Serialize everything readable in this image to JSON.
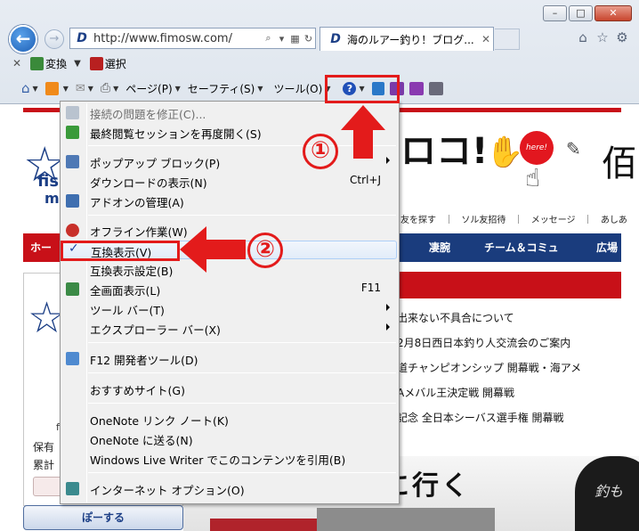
{
  "browser": {
    "url": "http://www.fimosw.com/",
    "tab_title": "海のルアー釣り！ブログ...",
    "tab_close": "✕"
  },
  "command_bar_1": {
    "close": "✕",
    "convert": "変換",
    "select": "選択"
  },
  "command_bar_2": {
    "page": "ページ(P)",
    "safety": "セーフティ(S)",
    "tools": "ツール(O)"
  },
  "tools_menu": {
    "items": [
      {
        "label": "接続の問題を修正(C)...",
        "disabled": true
      },
      {
        "label": "最終閲覧セッションを再度開く(S)"
      },
      {
        "label": "ポップアップ ブロック(P)",
        "submenu": true
      },
      {
        "label": "ダウンロードの表示(N)",
        "shortcut": "Ctrl+J"
      },
      {
        "label": "アドオンの管理(A)"
      },
      {
        "label": "オフライン作業(W)"
      },
      {
        "label": "互換表示(V)",
        "checked": true,
        "check_mark": "✓"
      },
      {
        "label": "互換表示設定(B)"
      },
      {
        "label": "全画面表示(L)",
        "shortcut": "F11"
      },
      {
        "label": "ツール バー(T)",
        "submenu": true
      },
      {
        "label": "エクスプローラー バー(X)",
        "submenu": true
      },
      {
        "label": "F12 開発者ツール(D)"
      },
      {
        "label": "おすすめサイト(G)"
      },
      {
        "label": "OneNote リンク ノート(K)"
      },
      {
        "label": "OneNote に送る(N)"
      },
      {
        "label": "Windows Live Writer でこのコンテンツを引用(B)"
      },
      {
        "label": "インターネット オプション(O)"
      }
    ]
  },
  "annotations": {
    "step1": "①",
    "step2": "②"
  },
  "page": {
    "logo_fi": "fis",
    "logo_m": "m",
    "header_text": "ロコ!",
    "header_text2": "佰",
    "here_badge": "here!",
    "subnav": [
      "友を探す",
      "｜",
      "ソル友招待",
      "｜",
      "メッセージ",
      "｜",
      "あしあ"
    ],
    "nav_home": "ホー",
    "nav_items": [
      "凄腕",
      "チーム＆コミュ",
      "広場"
    ],
    "news": [
      "出来ない不具合について",
      "2月8日西日本釣り人交流会のご案内",
      "道チャンピオンシップ 開幕戦・海アメ",
      "Aメバル王決定戦 開幕戦",
      "記念 全日本シーバス選手権 開幕戦"
    ],
    "left_fi": "fi",
    "left_text1": "保有",
    "left_text2": "累計",
    "post_button": "ぽーする",
    "banner_text": "に行く",
    "shirt_text": "釣も"
  }
}
